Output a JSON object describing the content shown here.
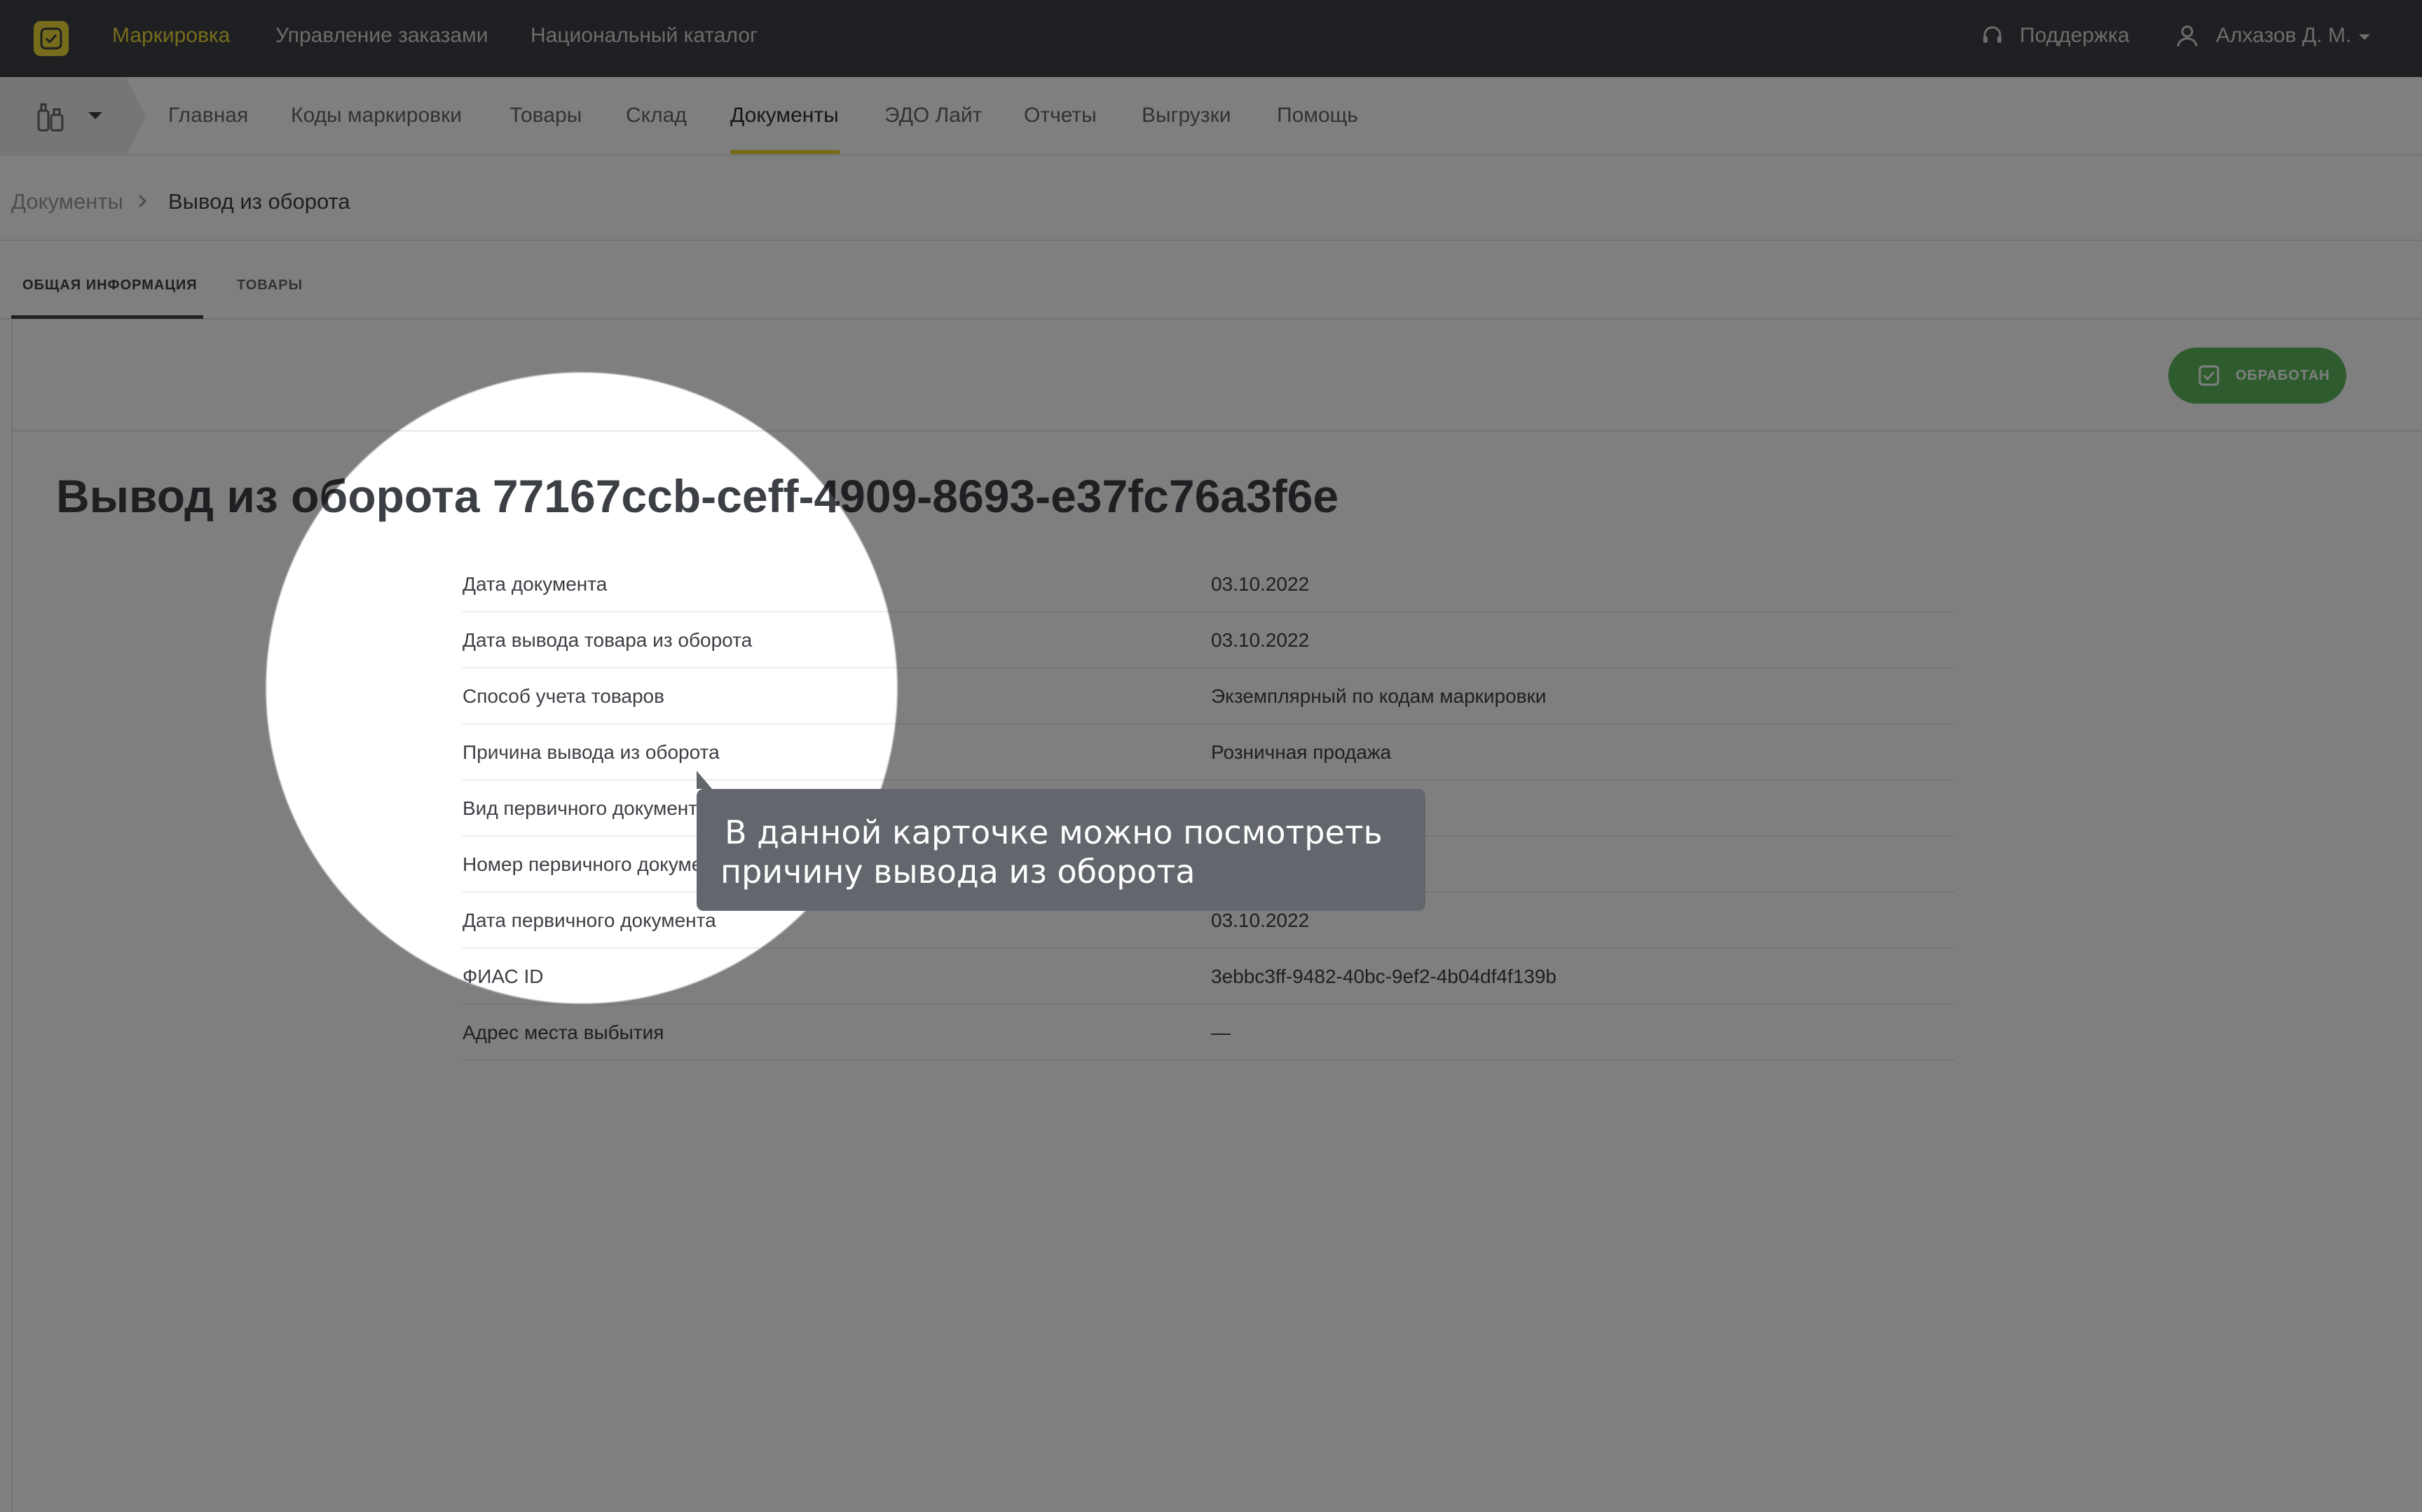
{
  "topnav": {
    "items": [
      "Маркировка",
      "Управление заказами",
      "Национальный каталог"
    ],
    "support": "Поддержка",
    "user": "Алхазов Д. М."
  },
  "subnav": {
    "items": [
      "Главная",
      "Коды маркировки",
      "Товары",
      "Склад",
      "Документы",
      "ЭДО Лайт",
      "Отчеты",
      "Выгрузки",
      "Помощь"
    ],
    "active": "Документы"
  },
  "breadcrumbs": {
    "parent": "Документы",
    "current": "Вывод из оборота"
  },
  "tabs": {
    "general": "ОБЩАЯ ИНФОРМАЦИЯ",
    "goods": "ТОВАРЫ"
  },
  "status": {
    "label": "ОБРАБОТАН",
    "color": "#5cb85c"
  },
  "document": {
    "title": "Вывод из оборота 77167ccb-ceff-4909-8693-e37fc76a3f6e",
    "fields": [
      {
        "key": "Дата документа",
        "value": "03.10.2022"
      },
      {
        "key": "Дата вывода товара из оборота",
        "value": "03.10.2022"
      },
      {
        "key": "Способ учета товаров",
        "value": "Экземплярный по кодам маркировки"
      },
      {
        "key": "Причина вывода из оборота",
        "value": "Розничная продажа"
      },
      {
        "key": "Вид первичного документа",
        "value": ""
      },
      {
        "key": "Номер первичного документа",
        "value": ""
      },
      {
        "key": "Дата первичного документа",
        "value": "03.10.2022"
      },
      {
        "key": "ФИАС ID",
        "value": "3ebbc3ff-9482-40bc-9ef2-4b04df4f139b"
      },
      {
        "key": "Адрес места выбытия",
        "value": "—"
      }
    ]
  },
  "tooltip": {
    "line1": "В данной карточке можно посмотреть",
    "line2": "причину вывода из оборота"
  },
  "colors": {
    "accent": "#ecd939",
    "topbar": "#3c3f44",
    "status_green": "#5cb85c"
  },
  "icons": [
    "logo-icon",
    "headset-icon",
    "user-icon",
    "caret-down-icon",
    "bottles-icon",
    "chevron-right-icon",
    "checkbox-icon"
  ]
}
